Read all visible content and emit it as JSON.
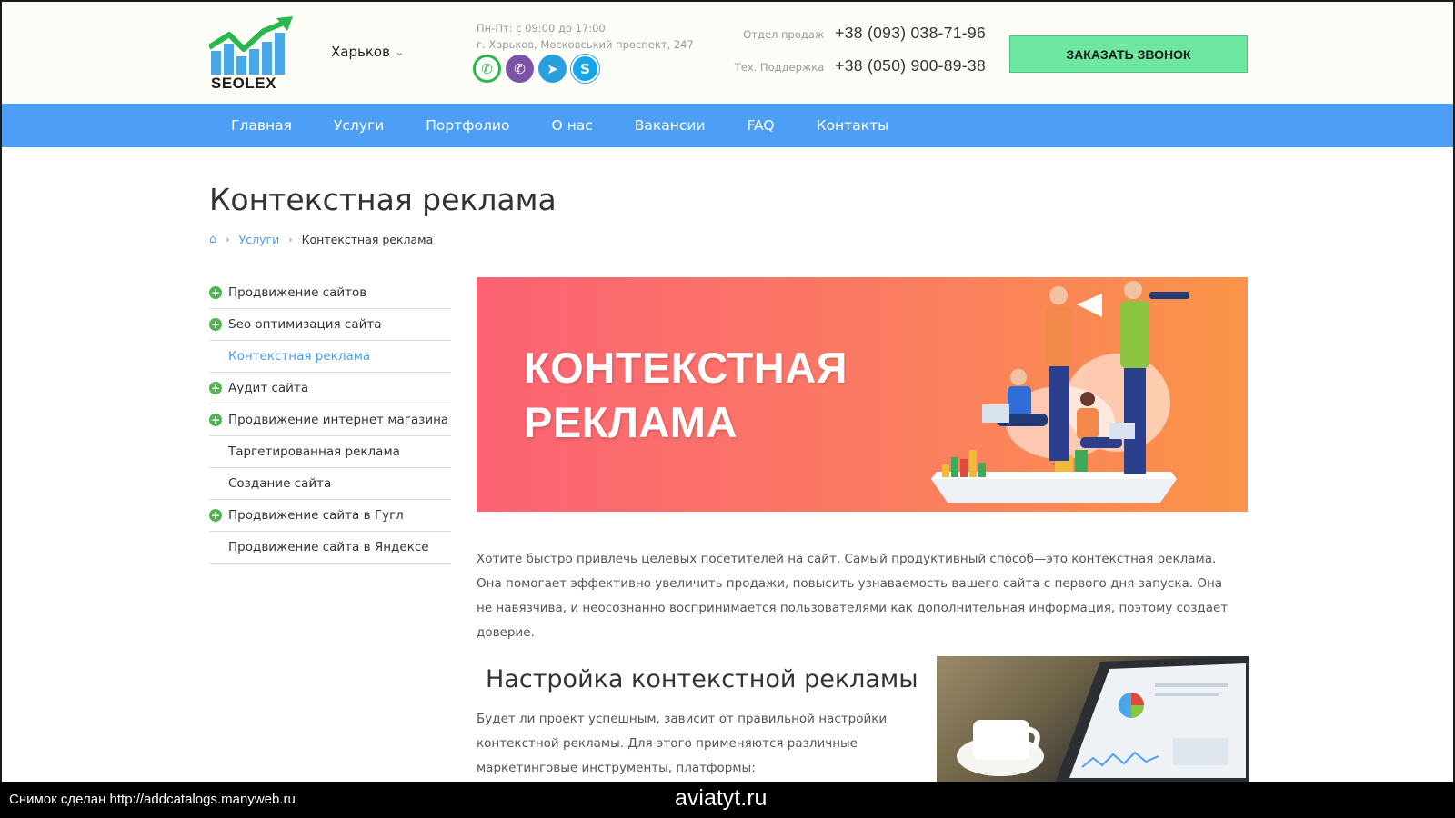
{
  "header": {
    "logo_text": "SEOLEX",
    "city": "Харьков",
    "hours_line1": "Пн-Пт: с 09:00 до 17:00",
    "hours_line2": "г. Харьков, Московський проспект, 247",
    "messengers": [
      "whatsapp-icon",
      "viber-icon",
      "telegram-icon",
      "skype-icon"
    ],
    "sales_label": "Отдел продаж",
    "sales_phone": "+38 (093) 038-71-96",
    "support_label": "Тех. Поддержка",
    "support_phone": "+38 (050) 900-89-38",
    "call_button": "ЗАКАЗАТЬ ЗВОНОК"
  },
  "nav": {
    "items": [
      "Главная",
      "Услуги",
      "Портфолио",
      "О нас",
      "Вакансии",
      "FAQ",
      "Контакты"
    ]
  },
  "page": {
    "title": "Контекстная реклама",
    "breadcrumb": {
      "link": "Услуги",
      "current": "Контекстная реклама"
    }
  },
  "sidebar": {
    "items": [
      {
        "label": "Продвижение сайтов",
        "has_plus": true
      },
      {
        "label": "Seo оптимизация сайта",
        "has_plus": true
      },
      {
        "label": "Контекстная реклама",
        "has_plus": false,
        "active": true
      },
      {
        "label": "Аудит сайта",
        "has_plus": true
      },
      {
        "label": "Продвижение интернет магазина",
        "has_plus": true
      },
      {
        "label": "Таргетированная реклама",
        "has_plus": false
      },
      {
        "label": "Создание сайта",
        "has_plus": false
      },
      {
        "label": "Продвижение сайта в Гугл",
        "has_plus": true
      },
      {
        "label": "Продвижение сайта в Яндексе",
        "has_plus": false
      }
    ]
  },
  "banner": {
    "line1": "КОНТЕКСТНАЯ",
    "line2": "РЕКЛАМА"
  },
  "content": {
    "intro": "Хотите быстро привлечь целевых посетителей на сайт. Самый продуктивный способ—это контекстная реклама. Она помогает эффективно увеличить продажи, повысить узнаваемость вашего сайта с первого дня запуска. Она не навязчива, и неосознанно воспринимается пользователями как дополнительная информация, поэтому создает доверие.",
    "h2": "Настройка контекстной рекламы",
    "para2": "Будет ли проект успешным, зависит от правильной настройки контекстной рекламы. Для этого применяются различные маркетинговые инструменты, платформы:"
  },
  "footer": {
    "snapshot": "Снимок сделан http://addcatalogs.manyweb.ru",
    "site": "aviatyt.ru"
  },
  "colors": {
    "nav_blue": "#4d9ef5",
    "button_green": "#6ee8a0",
    "plus_green": "#52b352",
    "banner_start": "#fb6274",
    "banner_end": "#fb9448"
  }
}
